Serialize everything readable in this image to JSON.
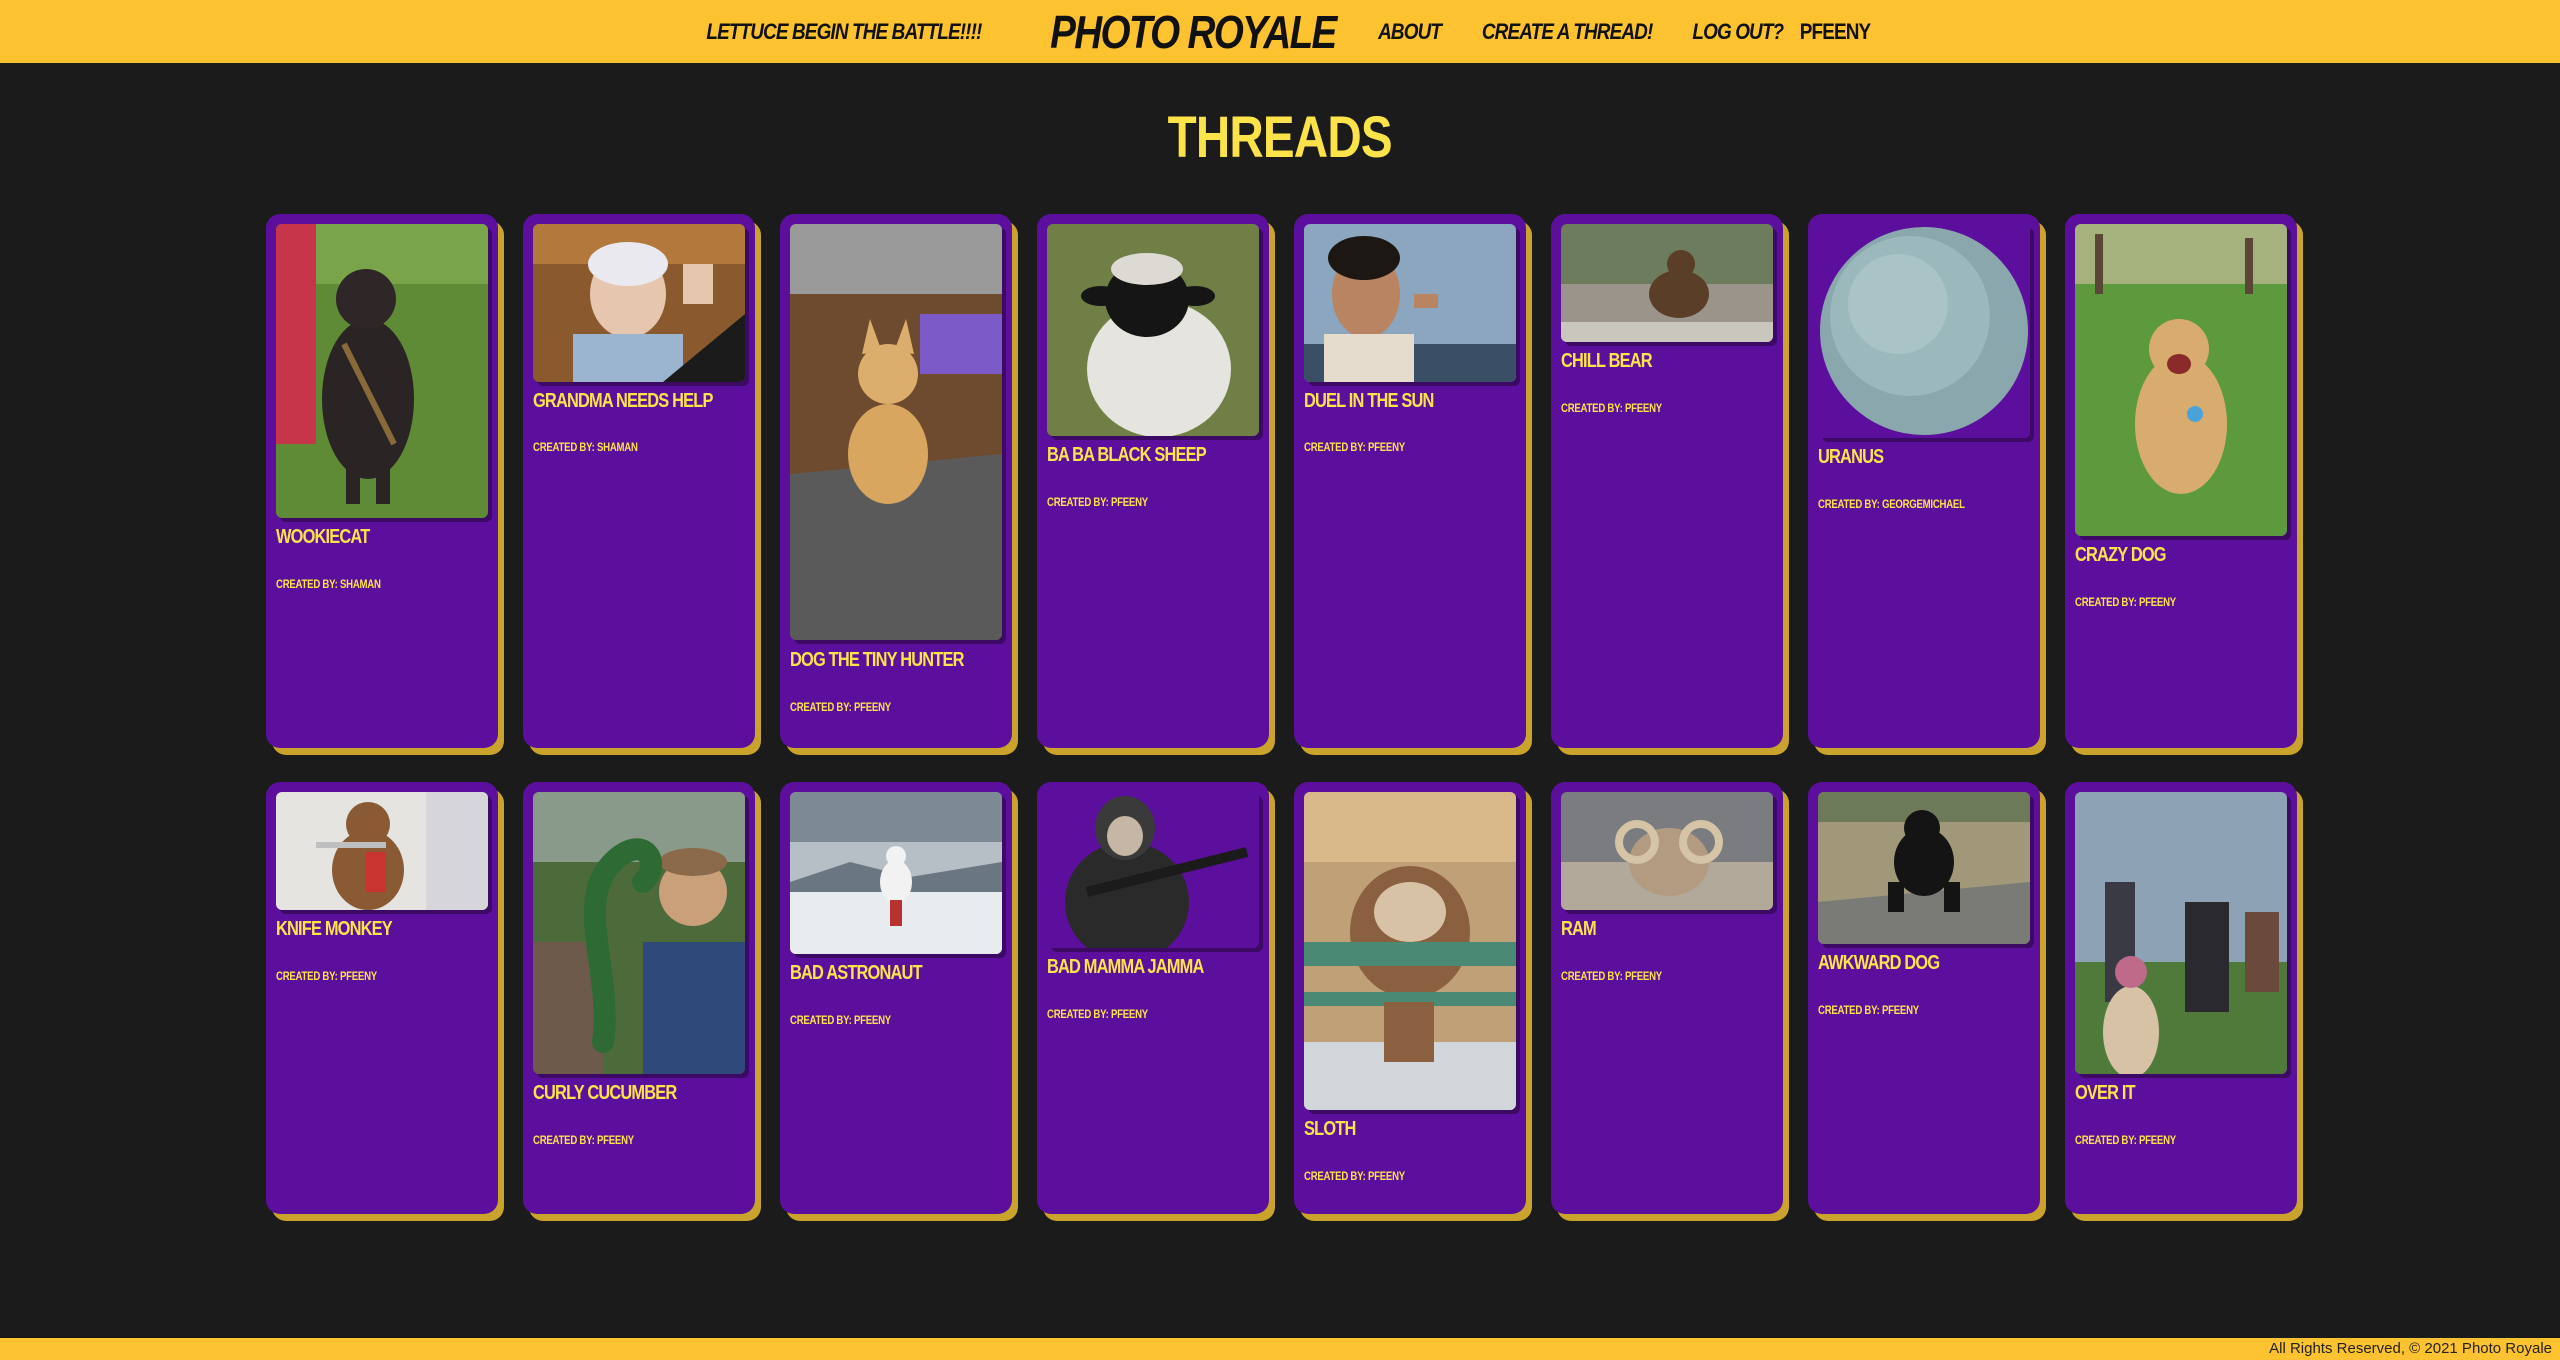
{
  "nav": {
    "tagline": "Lettuce begin the battle!!!!",
    "brand": "Photo Royale",
    "about": "About",
    "create": "Create a thread!",
    "logout": "Log out?",
    "username": "Pfeeny"
  },
  "page": {
    "title": "Threads"
  },
  "threads": [
    {
      "title": "Wookiecat",
      "author": "Created By: Shaman",
      "icon": "cat-photo"
    },
    {
      "title": "Grandma Needs Help",
      "author": "Created By: Shaman",
      "icon": "grandma-photo"
    },
    {
      "title": "Dog the Tiny Hunter",
      "author": "Created By: Pfeeny",
      "icon": "dog-photo"
    },
    {
      "title": "Ba Ba Black Sheep",
      "author": "Created By: Pfeeny",
      "icon": "sheep-photo"
    },
    {
      "title": "Duel in the Sun",
      "author": "Created By: Pfeeny",
      "icon": "man-sunset-photo"
    },
    {
      "title": "Chill Bear",
      "author": "Created By: Pfeeny",
      "icon": "bear-photo"
    },
    {
      "title": "Uranus",
      "author": "Created By: GeorgeMichael",
      "icon": "planet-photo"
    },
    {
      "title": "Crazy Dog",
      "author": "Created By: Pfeeny",
      "icon": "dog-photo"
    },
    {
      "title": "Knife Monkey",
      "author": "Created By: Pfeeny",
      "icon": "monkey-photo"
    },
    {
      "title": "Curly Cucumber",
      "author": "Created By: Pfeeny",
      "icon": "cucumber-photo"
    },
    {
      "title": "Bad Astronaut",
      "author": "Created By: Pfeeny",
      "icon": "astronaut-photo"
    },
    {
      "title": "Bad Mamma Jamma",
      "author": "Created By: Pfeeny",
      "icon": "woman-rifle-photo"
    },
    {
      "title": "Sloth",
      "author": "Created By: Pfeeny",
      "icon": "sloth-photo"
    },
    {
      "title": "Ram",
      "author": "Created By: Pfeeny",
      "icon": "ram-photo"
    },
    {
      "title": "Awkward Dog",
      "author": "Created By: Pfeeny",
      "icon": "dog-photo"
    },
    {
      "title": "Over It",
      "author": "Created By: Pfeeny",
      "icon": "party-photo"
    }
  ],
  "footer": {
    "text": "All Rights Reserved, © 2021 Photo Royale"
  },
  "colors": {
    "nav_bg": "#fdc22f",
    "page_bg": "#1b1b1b",
    "card_bg": "#5c0f9c",
    "card_shadow": "#c9a32b",
    "accent_text": "#fde34a"
  }
}
